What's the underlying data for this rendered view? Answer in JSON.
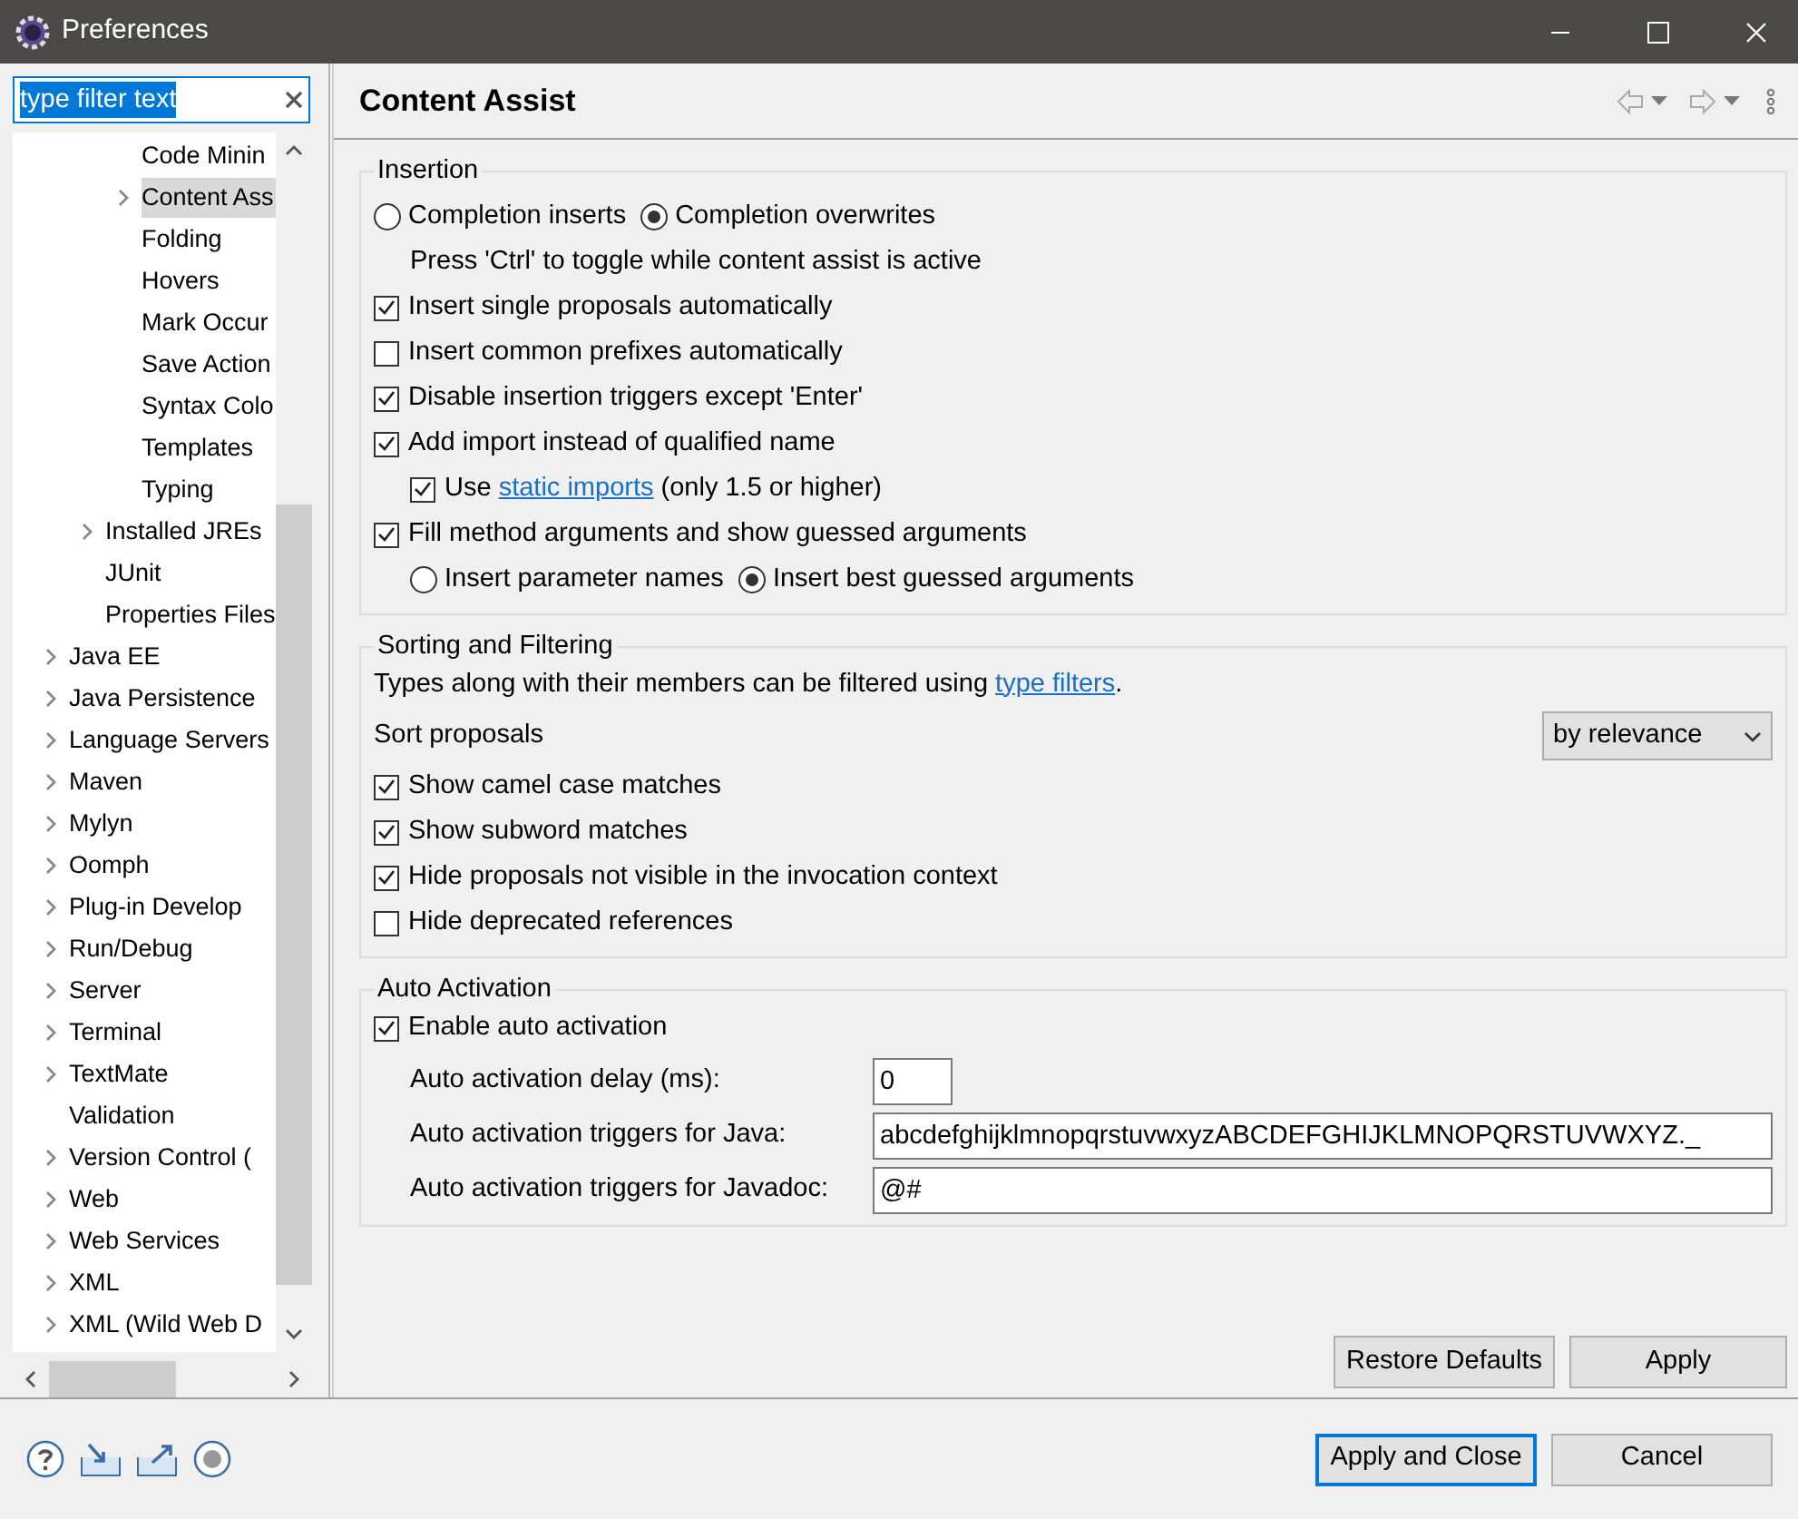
{
  "window": {
    "title": "Preferences"
  },
  "filter": {
    "value": "type filter text",
    "text_selected": true
  },
  "tree": [
    {
      "children": [
        {
          "children": [
            {
              "label": "Code Minin",
              "expandable": false,
              "selected": false
            },
            {
              "label": "Content Ass",
              "expandable": true,
              "selected": true
            },
            {
              "label": "Folding",
              "expandable": false,
              "selected": false
            },
            {
              "label": "Hovers",
              "expandable": false,
              "selected": false
            },
            {
              "label": "Mark Occur",
              "expandable": false,
              "selected": false
            },
            {
              "label": "Save Action",
              "expandable": false,
              "selected": false
            },
            {
              "label": "Syntax Colo",
              "expandable": false,
              "selected": false
            },
            {
              "label": "Templates",
              "expandable": false,
              "selected": false
            },
            {
              "label": "Typing",
              "expandable": false,
              "selected": false
            }
          ]
        },
        {
          "label": "Installed JREs",
          "expandable": true,
          "selected": false
        },
        {
          "label": "JUnit",
          "expandable": false,
          "selected": false
        },
        {
          "label": "Properties Files",
          "expandable": false,
          "selected": false
        }
      ]
    },
    {
      "label": "Java EE",
      "expandable": true,
      "selected": false
    },
    {
      "label": "Java Persistence",
      "expandable": true,
      "selected": false
    },
    {
      "label": "Language Servers",
      "expandable": true,
      "selected": false
    },
    {
      "label": "Maven",
      "expandable": true,
      "selected": false
    },
    {
      "label": "Mylyn",
      "expandable": true,
      "selected": false
    },
    {
      "label": "Oomph",
      "expandable": true,
      "selected": false
    },
    {
      "label": "Plug-in Develop",
      "expandable": true,
      "selected": false
    },
    {
      "label": "Run/Debug",
      "expandable": true,
      "selected": false
    },
    {
      "label": "Server",
      "expandable": true,
      "selected": false
    },
    {
      "label": "Terminal",
      "expandable": true,
      "selected": false
    },
    {
      "label": "TextMate",
      "expandable": true,
      "selected": false
    },
    {
      "label": "Validation",
      "expandable": false,
      "selected": false
    },
    {
      "label": "Version Control (",
      "expandable": true,
      "selected": false
    },
    {
      "label": "Web",
      "expandable": true,
      "selected": false
    },
    {
      "label": "Web Services",
      "expandable": true,
      "selected": false
    },
    {
      "label": "XML",
      "expandable": true,
      "selected": false
    },
    {
      "label": "XML (Wild Web D",
      "expandable": true,
      "selected": false
    }
  ],
  "page": {
    "title": "Content Assist"
  },
  "sections": [
    {
      "title": "Insertion",
      "items": [
        {
          "kind": "radios",
          "options": [
            {
              "label": "Completion inserts",
              "selected": false
            },
            {
              "label": "Completion overwrites",
              "selected": true
            }
          ],
          "children": [
            {
              "kind": "note",
              "text": "Press 'Ctrl' to toggle while content assist is active"
            }
          ]
        },
        {
          "kind": "checkbox",
          "label": "Insert single proposals automatically",
          "checked": true
        },
        {
          "kind": "checkbox",
          "label": "Insert common prefixes automatically",
          "checked": false
        },
        {
          "kind": "checkbox",
          "label": "Disable insertion triggers except 'Enter'",
          "checked": true
        },
        {
          "kind": "checkbox",
          "label": "Add import instead of qualified name",
          "checked": true,
          "children": [
            {
              "kind": "checkbox",
              "label": "Use ",
              "link": "static imports",
              "after": " (only 1.5 or higher)",
              "checked": true
            }
          ]
        },
        {
          "kind": "checkbox",
          "label": "Fill method arguments and show guessed arguments",
          "checked": true,
          "children": [
            {
              "kind": "radios",
              "options": [
                {
                  "label": "Insert parameter names",
                  "selected": false
                },
                {
                  "label": "Insert best guessed arguments",
                  "selected": true
                }
              ]
            }
          ]
        }
      ]
    },
    {
      "title": "Sorting and Filtering",
      "items": [
        {
          "kind": "note",
          "text": "Types along with their members can be filtered using ",
          "link": "type filters",
          "after": "."
        },
        {
          "kind": "select",
          "label": "Sort proposals",
          "value": "by relevance"
        },
        {
          "kind": "checkbox",
          "label": "Show camel case matches",
          "checked": true
        },
        {
          "kind": "checkbox",
          "label": "Show subword matches",
          "checked": true
        },
        {
          "kind": "checkbox",
          "label": "Hide proposals not visible in the invocation context",
          "checked": true
        },
        {
          "kind": "checkbox",
          "label": "Hide deprecated references",
          "checked": false
        }
      ]
    },
    {
      "title": "Auto Activation",
      "items": [
        {
          "kind": "checkbox",
          "label": "Enable auto activation",
          "checked": true,
          "children": [
            {
              "kind": "number_field",
              "label": "Auto activation delay (ms):",
              "value": "0"
            },
            {
              "kind": "text_field",
              "label": "Auto activation triggers for Java:",
              "value": "abcdefghijklmnopqrstuvwxyzABCDEFGHIJKLMNOPQRSTUVWXYZ._"
            },
            {
              "kind": "text_field",
              "label": "Auto activation triggers for Javadoc:",
              "value": "@#"
            }
          ]
        }
      ]
    }
  ],
  "page_buttons": [
    {
      "label": "Restore Defaults"
    },
    {
      "label": "Apply"
    }
  ],
  "dialog_buttons": [
    {
      "label": "Apply and Close",
      "default": true
    },
    {
      "label": "Cancel",
      "default": false
    }
  ]
}
